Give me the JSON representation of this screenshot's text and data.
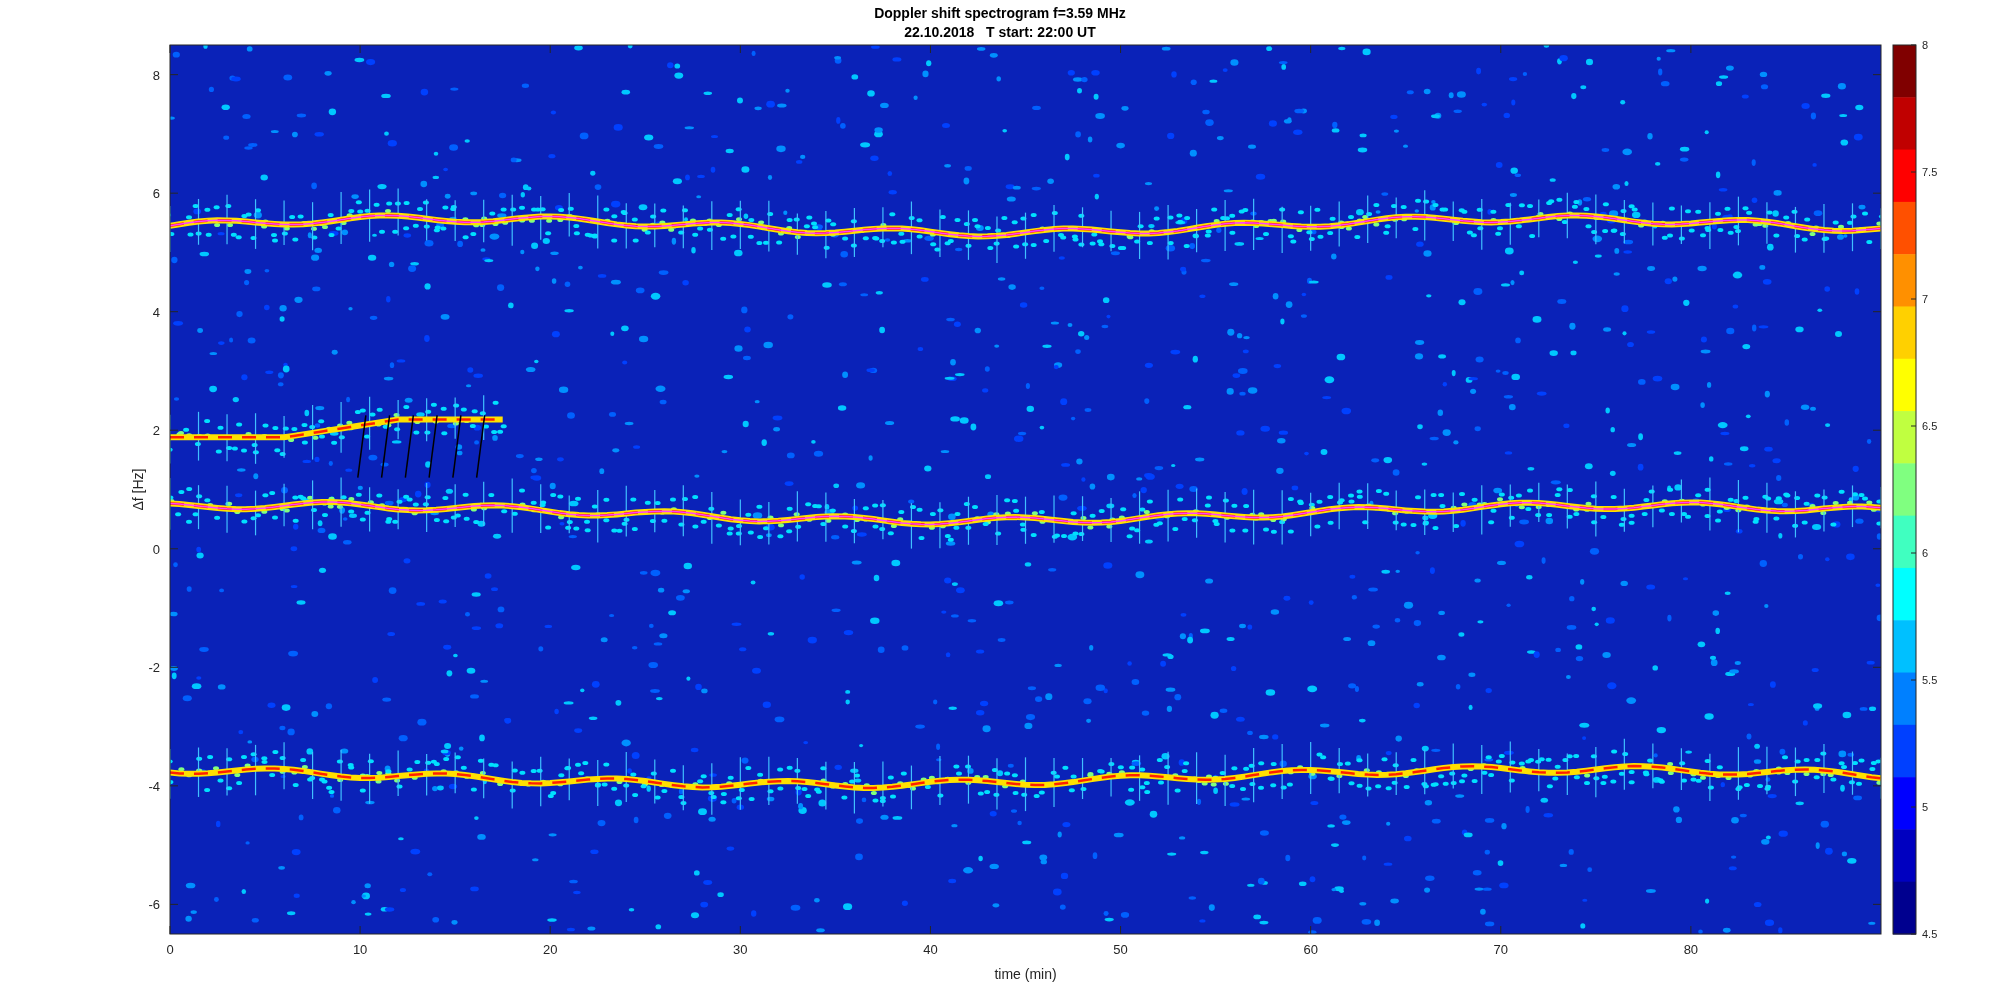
{
  "figure": {
    "title_lines": [
      "Doppler shift spectrogram f=3.59 MHz",
      "22.10.2018   T start: 22:00 UT"
    ],
    "xlabel": "time (min)",
    "ylabel": "Δf [Hz]",
    "xticks": [
      "0",
      "10",
      "20",
      "30",
      "40",
      "50",
      "60",
      "70",
      "80"
    ],
    "yticks": [
      "8",
      "6",
      "4",
      "2",
      "0",
      "-2",
      "-4",
      "-6"
    ],
    "colorbar_ticks": [
      "8",
      "7.5",
      "7",
      "6.5",
      "6",
      "5.5",
      "5",
      "4.5"
    ]
  }
}
